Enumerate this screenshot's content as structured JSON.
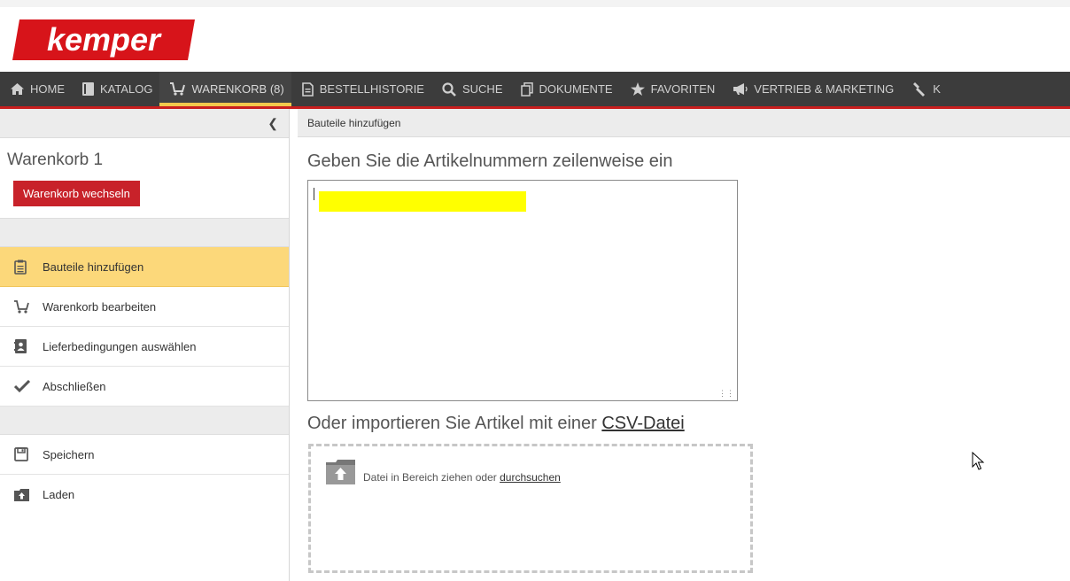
{
  "brand": {
    "logo_text": "kemper",
    "color": "#d7141a"
  },
  "nav": {
    "items": [
      {
        "label": "HOME",
        "icon": "home-icon"
      },
      {
        "label": "KATALOG",
        "icon": "book-icon"
      },
      {
        "label": "WARENKORB (8)",
        "icon": "cart-icon",
        "active": true
      },
      {
        "label": "BESTELLHISTORIE",
        "icon": "document-icon"
      },
      {
        "label": "SUCHE",
        "icon": "search-icon"
      },
      {
        "label": "DOKUMENTE",
        "icon": "copy-icon"
      },
      {
        "label": "FAVORITEN",
        "icon": "star-icon"
      },
      {
        "label": "VERTRIEB & MARKETING",
        "icon": "megaphone-icon"
      },
      {
        "label": "K",
        "icon": "wrench-icon"
      }
    ],
    "active_color": "#f2c94c",
    "accent_color": "#c81e1e"
  },
  "sidebar": {
    "collapse_icon": "chevron-left-icon",
    "cart_title": "Warenkorb 1",
    "switch_button": "Warenkorb wechseln",
    "steps": [
      {
        "label": "Bauteile hinzufügen",
        "icon": "clipboard-icon",
        "active": true
      },
      {
        "label": "Warenkorb bearbeiten",
        "icon": "cart-icon"
      },
      {
        "label": "Lieferbedingungen auswählen",
        "icon": "contact-book-icon"
      },
      {
        "label": "Abschließen",
        "icon": "check-icon"
      }
    ],
    "actions": [
      {
        "label": "Speichern",
        "icon": "floppy-disk-icon"
      },
      {
        "label": "Laden",
        "icon": "folder-upload-icon"
      }
    ]
  },
  "main": {
    "breadcrumb": "Bauteile hinzufügen",
    "enter_heading": "Geben Sie die Artikelnummern zeilenweise ein",
    "import_heading_prefix": "Oder importieren Sie Artikel mit einer ",
    "import_link": "CSV-Datei",
    "dropzone_text_prefix": "Datei in Bereich ziehen oder ",
    "dropzone_link": "durchsuchen"
  }
}
